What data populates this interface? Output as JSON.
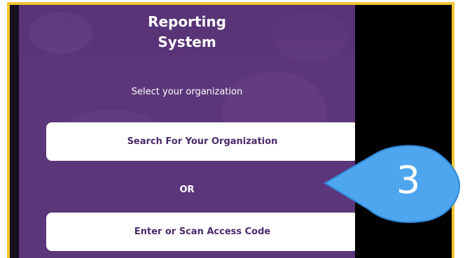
{
  "app": {
    "title": "Reporting\nSystem",
    "subtitle": "Select your organization",
    "search_button_label": "Search For Your Organization",
    "or_label": "OR",
    "access_code_button_label": "Enter or Scan Access Code"
  },
  "annotation": {
    "step_number": "3"
  },
  "colors": {
    "app_background": "#5c367a",
    "button_text": "#4b2a6b",
    "highlight_frame": "#f3c431",
    "callout_fill": "#4ea6ef"
  }
}
